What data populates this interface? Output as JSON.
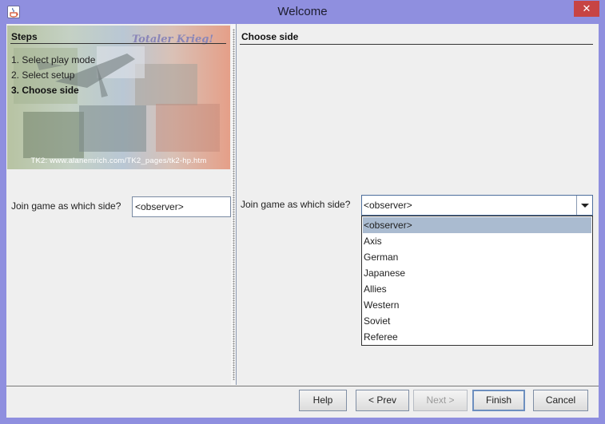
{
  "window": {
    "title": "Welcome",
    "app_icon": "java-coffee-cup-icon",
    "close_glyph": "✕"
  },
  "steps": {
    "title": "Steps",
    "watermark_title": "Totaler Krieg!",
    "items": [
      {
        "label": "1. Select play mode",
        "active": false
      },
      {
        "label": "2. Select setup",
        "active": false
      },
      {
        "label": "3. Choose side",
        "active": true
      }
    ],
    "caption": "TK2: www.alanemrich.com/TK2_pages/tk2-hp.htm"
  },
  "left_join": {
    "label": "Join game as which side?",
    "value": "<observer>"
  },
  "choose_side": {
    "title": "Choose side",
    "label": "Join game as which side?",
    "value": "<observer>",
    "options": [
      "<observer>",
      "Axis",
      "German",
      "Japanese",
      "Allies",
      "Western",
      "Soviet",
      "Referee"
    ],
    "selected_index": 0
  },
  "buttons": {
    "help": "Help",
    "prev": "< Prev",
    "next": "Next >",
    "finish": "Finish",
    "cancel": "Cancel"
  },
  "colors": {
    "titlebar": "#8f8fdf",
    "close": "#c74444",
    "selection": "#aabbd0",
    "panel": "#efefef"
  }
}
